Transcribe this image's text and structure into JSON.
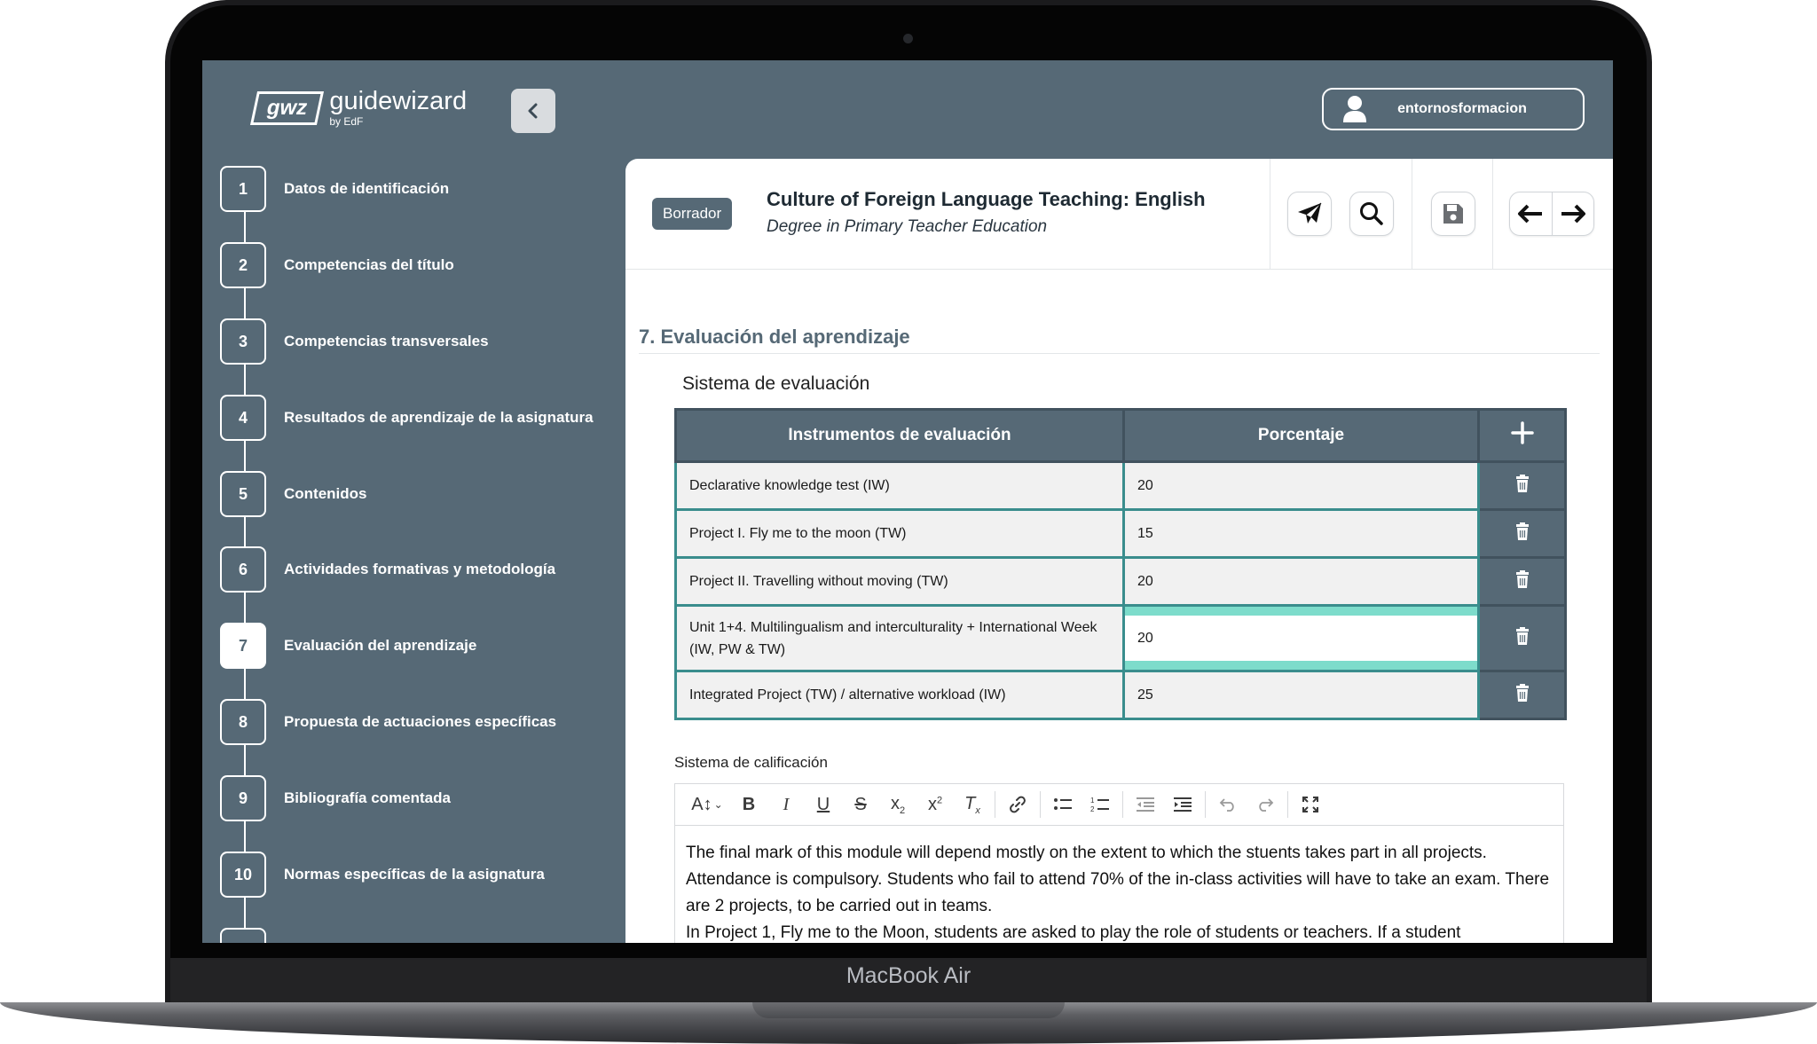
{
  "device": {
    "brand": "MacBook Air"
  },
  "app": {
    "logo_mark": "gwz",
    "logo_word": "guidewizard",
    "logo_by": "by EdF",
    "user": "entornosformacion"
  },
  "sidebar": {
    "steps": [
      {
        "num": "1",
        "label": "Datos de identificación"
      },
      {
        "num": "2",
        "label": "Competencias del título"
      },
      {
        "num": "3",
        "label": "Competencias transversales"
      },
      {
        "num": "4",
        "label": "Resultados de aprendizaje de la asignatura"
      },
      {
        "num": "5",
        "label": "Contenidos"
      },
      {
        "num": "6",
        "label": "Actividades formativas y metodología"
      },
      {
        "num": "7",
        "label": "Evaluación del aprendizaje"
      },
      {
        "num": "8",
        "label": "Propuesta de actuaciones específicas"
      },
      {
        "num": "9",
        "label": "Bibliografía comentada"
      },
      {
        "num": "10",
        "label": "Normas específicas de la asignatura"
      }
    ],
    "active": "7"
  },
  "header": {
    "badge": "Borrador",
    "title": "Culture of Foreign Language Teaching: English",
    "subtitle": "Degree in Primary Teacher Education"
  },
  "section": {
    "title": "7. Evaluación del aprendizaje",
    "subtitle": "Sistema de evaluación"
  },
  "table": {
    "headers": [
      "Instrumentos de evaluación",
      "Porcentaje"
    ],
    "rows": [
      {
        "instrument": "Declarative knowledge test (IW)",
        "percent": "20"
      },
      {
        "instrument": "Project I. Fly me to the moon (TW)",
        "percent": "15"
      },
      {
        "instrument": "Project II. Travelling without moving (TW)",
        "percent": "20"
      },
      {
        "instrument": "Unit 1+4. Multilingualism and interculturality + International Week (IW, PW & TW)",
        "percent": "20"
      },
      {
        "instrument": "Integrated Project (TW) / alternative workload (IW)",
        "percent": "25"
      }
    ]
  },
  "grading": {
    "label": "Sistema de calificación",
    "paragraphs": [
      "The final mark of this module will depend mostly on the extent to which the stuents takes part in all projects. Attendance is compulsory. Students who fail to attend 70% of the in-class activities will have to take an exam. There are 2 projects, to be carried out in teams.",
      "In Project 1, Fly me to the Moon, students are asked to play the role of students or teachers. If a student"
    ]
  },
  "colors": {
    "brand": "#566976",
    "table_border": "#3a8d8d",
    "focus": "#7ddccb"
  }
}
